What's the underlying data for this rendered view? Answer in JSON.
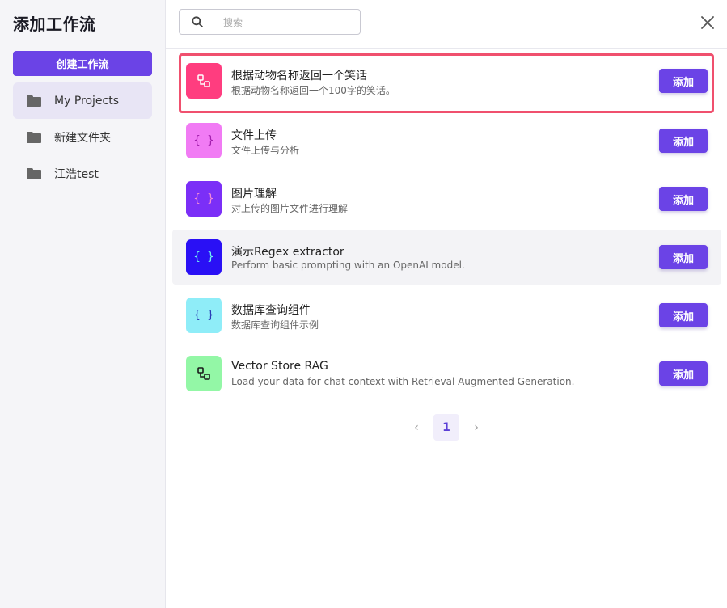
{
  "sidebar": {
    "title": "添加工作流",
    "create_button": "创建工作流",
    "folders": [
      {
        "label": "My Projects",
        "active": true
      },
      {
        "label": "新建文件夹",
        "active": false
      },
      {
        "label": "江浩test",
        "active": false
      }
    ]
  },
  "search": {
    "placeholder": "搜索",
    "value": ""
  },
  "workflows": [
    {
      "title": "根据动物名称返回一个笑话",
      "description": "根据动物名称返回一个100字的笑话。",
      "icon": "flow-icon",
      "icon_bg": "#ff3d7f",
      "icon_fg": "#ffffff",
      "add_label": "添加"
    },
    {
      "title": "文件上传",
      "description": "文件上传与分析",
      "icon": "braces-icon",
      "icon_bg": "#f17bf4",
      "icon_fg": "#a31fae",
      "add_label": "添加"
    },
    {
      "title": "图片理解",
      "description": "对上传的图片文件进行理解",
      "icon": "braces-icon",
      "icon_bg": "#7b2ff7",
      "icon_fg": "#f28ad6",
      "add_label": "添加"
    },
    {
      "title": "演示Regex extractor",
      "description": "Perform basic prompting with an OpenAI model.",
      "icon": "braces-icon",
      "icon_bg": "#2a10f5",
      "icon_fg": "#6ff0f0",
      "add_label": "添加"
    },
    {
      "title": "数据库查询组件",
      "description": "数据库查询组件示例",
      "icon": "braces-icon",
      "icon_bg": "#8fedf8",
      "icon_fg": "#2a3bb5",
      "add_label": "添加"
    },
    {
      "title": "Vector Store RAG",
      "description": "Load your data for chat context with Retrieval Augmented Generation.",
      "icon": "flow-icon",
      "icon_bg": "#93f7a6",
      "icon_fg": "#1a1a1a",
      "add_label": "添加"
    }
  ],
  "pagination": {
    "current": "1"
  },
  "colors": {
    "accent": "#6b43e6",
    "highlight_border": "#f0506e"
  }
}
